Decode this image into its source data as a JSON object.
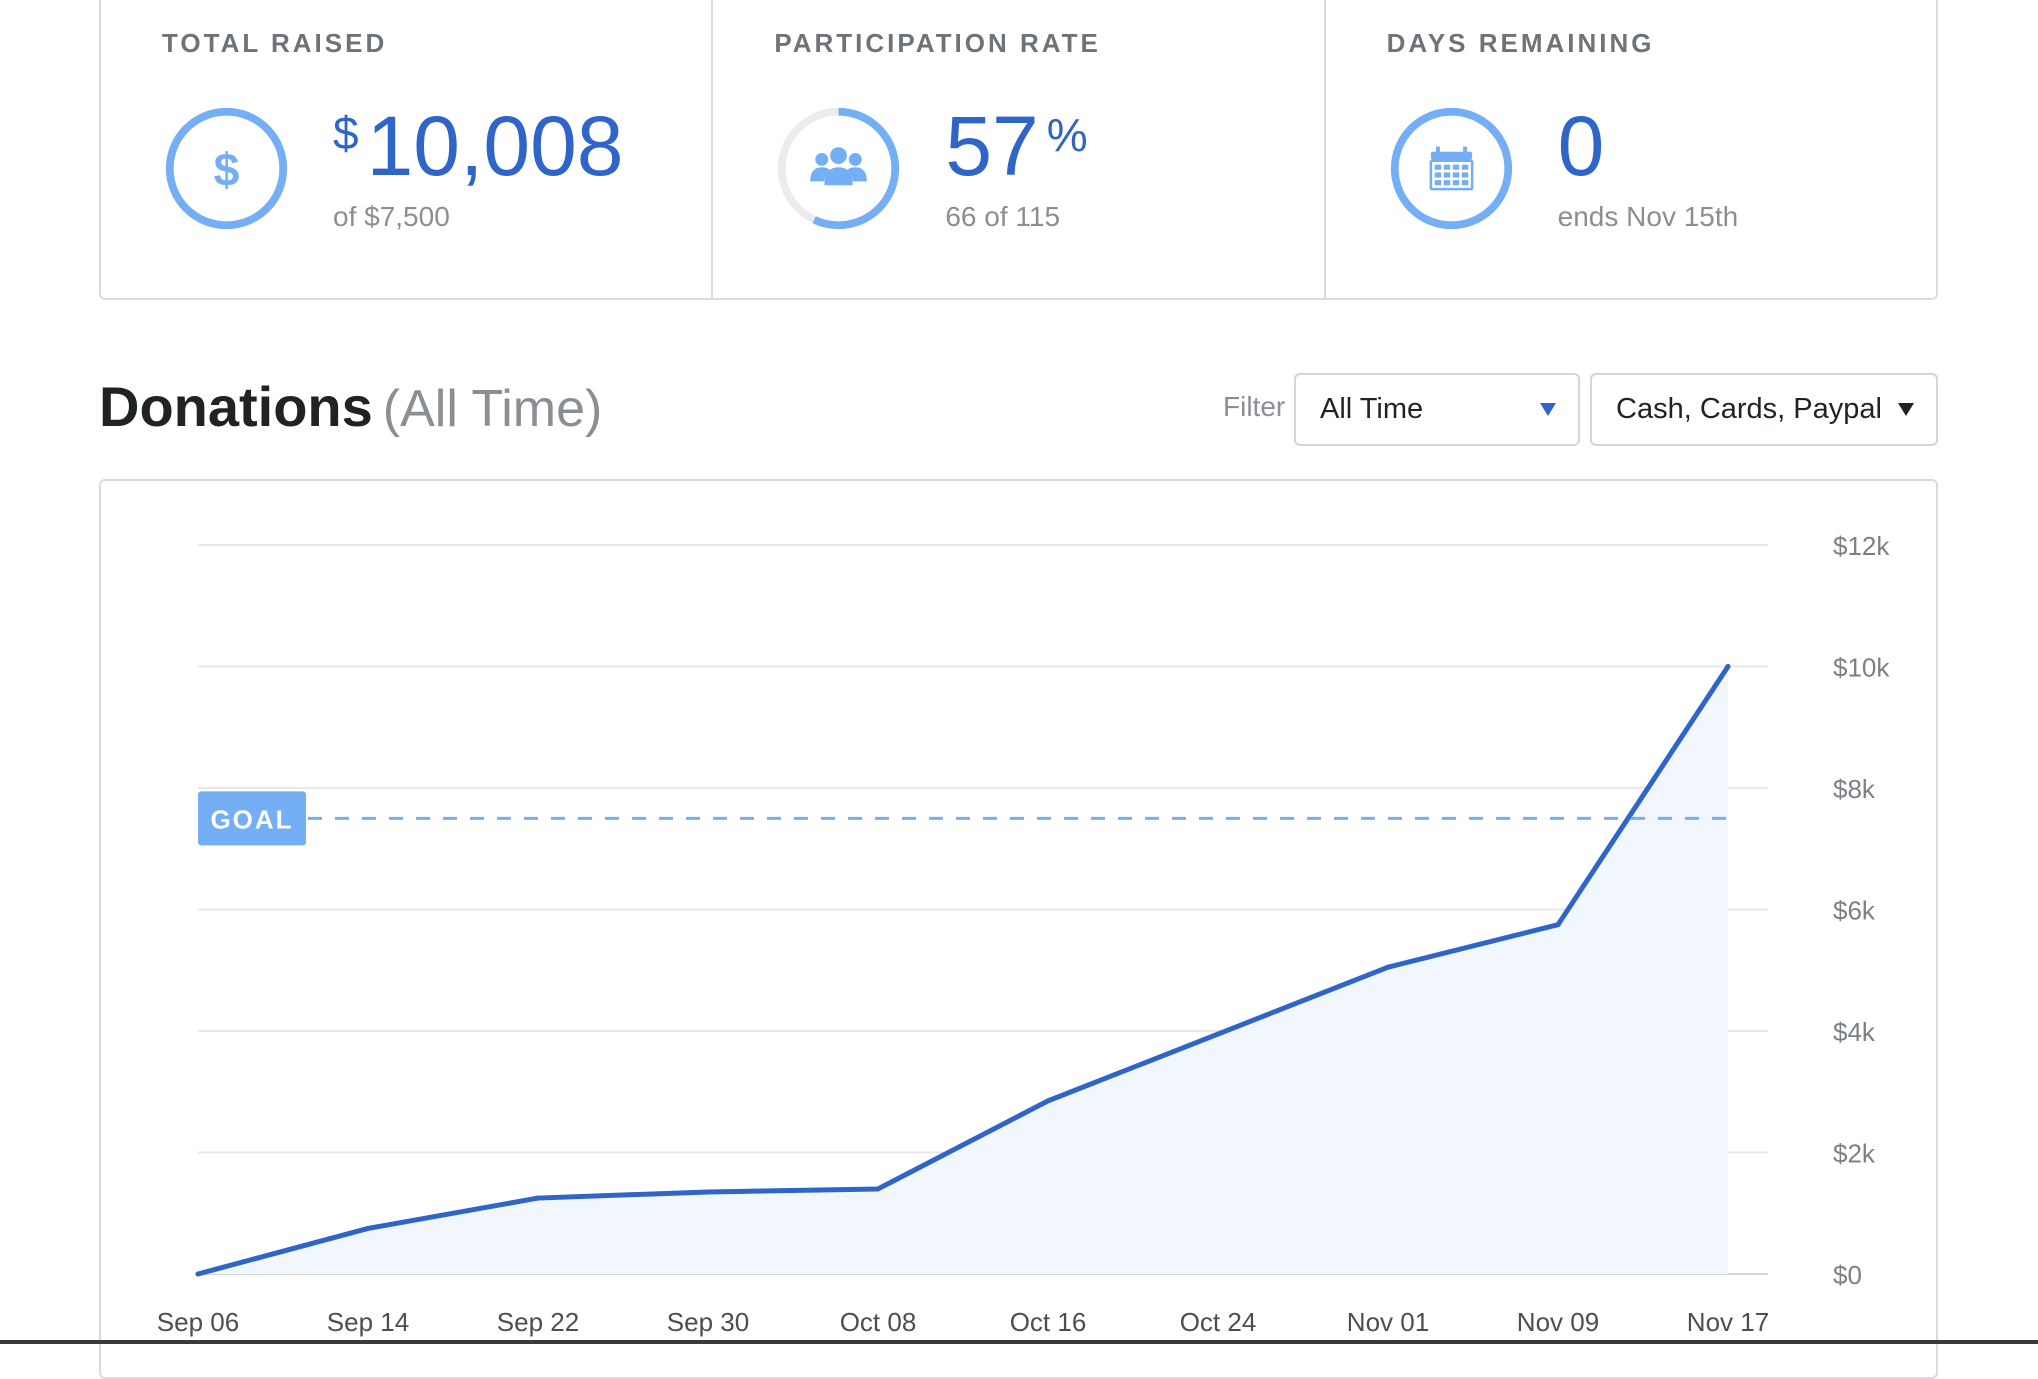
{
  "stats": [
    {
      "label": "TOTAL RAISED",
      "prefix": "$",
      "value": "10,008",
      "suffix": "",
      "sub": "of $7,500",
      "icon": "dollar-icon",
      "progress": 1.0
    },
    {
      "label": "PARTICIPATION RATE",
      "prefix": "",
      "value": "57",
      "suffix": "%",
      "sub": "66 of 115",
      "icon": "users-icon",
      "progress": 0.57
    },
    {
      "label": "DAYS REMAINING",
      "prefix": "",
      "value": "0",
      "suffix": "",
      "sub": "ends Nov 15th",
      "icon": "calendar-icon",
      "progress": 1.0
    }
  ],
  "section": {
    "title": "Donations",
    "subtitle": "(All Time)"
  },
  "filter": {
    "label": "Filter",
    "time_value": "All Time",
    "method_value": "Cash, Cards, Paypal"
  },
  "colors": {
    "accent": "#2f64c8",
    "ring": "#74aef4",
    "ring_track": "#ececec",
    "goal": "#74aef4",
    "area_fill": "#f2f7fe",
    "grid": "#e6e8ea"
  },
  "chart_data": {
    "type": "area",
    "title": "",
    "xlabel": "",
    "ylabel": "",
    "categories": [
      "Sep 06",
      "Sep 14",
      "Sep 22",
      "Sep 30",
      "Oct 08",
      "Oct 16",
      "Oct 24",
      "Nov 01",
      "Nov 09",
      "Nov 17"
    ],
    "y_ticks": [
      "$0",
      "$2k",
      "$4k",
      "$6k",
      "$8k",
      "$10k",
      "$12k"
    ],
    "ylim": [
      0,
      12000
    ],
    "y_axis_side": "right",
    "grid": true,
    "series": [
      {
        "values": [
          0,
          750,
          1250,
          1350,
          1400,
          2850,
          3950,
          5050,
          5750,
          10000
        ]
      }
    ],
    "goal": {
      "label": "GOAL",
      "value": 7500
    }
  }
}
